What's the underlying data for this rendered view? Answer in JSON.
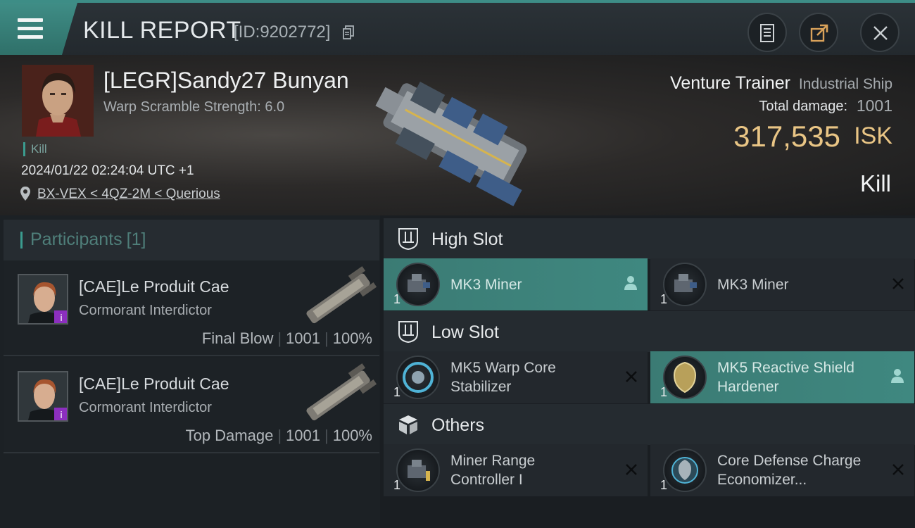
{
  "header": {
    "title": "KILL REPORT",
    "kill_id": "[ID:9202772]"
  },
  "victim": {
    "name": "[LEGR]Sandy27 Bunyan",
    "warp_scramble": "Warp Scramble Strength: 6.0",
    "tag": "Kill",
    "datetime": "2024/01/22 02:24:04 UTC +1",
    "location": "BX-VEX < 4QZ-2M < Querious"
  },
  "ship": {
    "name": "Venture Trainer",
    "class": "Industrial Ship",
    "total_damage_label": "Total damage:",
    "total_damage": "1001",
    "isk_value": "317,535",
    "isk_label": "ISK",
    "result": "Kill"
  },
  "participants": {
    "label": "Participants",
    "count": "[1]",
    "rows": [
      {
        "name": "[CAE]Le Produit Cae",
        "ship": "Cormorant Interdictor",
        "role": "Final Blow",
        "damage": "1001",
        "percent": "100%"
      },
      {
        "name": "[CAE]Le Produit Cae",
        "ship": "Cormorant Interdictor",
        "role": "Top Damage",
        "damage": "1001",
        "percent": "100%"
      }
    ]
  },
  "slots": {
    "high": {
      "label": "High Slot",
      "modules": [
        {
          "name": "MK3 Miner",
          "qty": "1",
          "status": "person-icon"
        },
        {
          "name": "MK3 Miner",
          "qty": "1",
          "status": "close-icon"
        }
      ]
    },
    "low": {
      "label": "Low Slot",
      "modules": [
        {
          "name1": "MK5 Warp Core",
          "name2": "Stabilizer",
          "qty": "1",
          "status": "close-icon"
        },
        {
          "name1": "MK5 Reactive Shield",
          "name2": "Hardener",
          "qty": "1",
          "status": "person-icon"
        }
      ]
    },
    "others": {
      "label": "Others",
      "modules": [
        {
          "name1": "Miner Range",
          "name2": "Controller I",
          "qty": "1",
          "status": "close-icon"
        },
        {
          "name1": "Core Defense Charge",
          "name2": "Economizer...",
          "qty": "1",
          "status": "close-icon"
        }
      ]
    }
  },
  "colors": {
    "accent": "#3f8880",
    "isk": "#e9c585"
  }
}
